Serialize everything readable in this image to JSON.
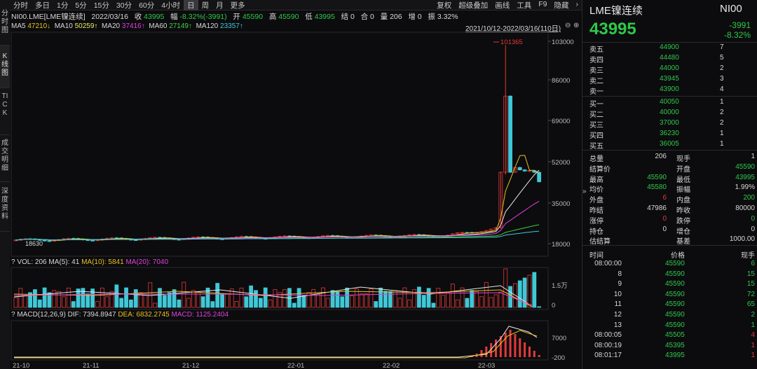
{
  "left_tabs": [
    "分时图",
    "K线图",
    "TICK",
    "成交明细",
    "深度资料"
  ],
  "periods": [
    "分时",
    "多日",
    "1分",
    "5分",
    "15分",
    "30分",
    "60分",
    "4小时",
    "日",
    "周",
    "月",
    "更多"
  ],
  "selected_period": "日",
  "toolbar_right": [
    "复权",
    "超级叠加",
    "画线",
    "工具",
    "F9",
    "隐藏"
  ],
  "info": {
    "symbol": "NI00.LME[LME镍连续]",
    "date": "2022/03/16",
    "close_label": "收",
    "close": "43995",
    "change_label": "幅",
    "change": "-8.32%(-3991)",
    "open_label": "开",
    "open": "45590",
    "high_label": "高",
    "high": "45590",
    "low_label": "低",
    "low": "43995",
    "settle_label": "结",
    "settle": "0",
    "pos_label": "合",
    "pos": "0",
    "vol_label": "量",
    "vol": "206",
    "inc_label": "增",
    "inc": "0",
    "amp_label": "振",
    "amp": "3.32%"
  },
  "ma": [
    {
      "label": "MA5",
      "value": "47210↓",
      "color": "#e8c020"
    },
    {
      "label": "MA10",
      "value": "50259↑",
      "color": "#e8e8e8"
    },
    {
      "label": "MA20",
      "value": "37416↑",
      "color": "#e040e0"
    },
    {
      "label": "MA60",
      "value": "27149↑",
      "color": "#40d040"
    },
    {
      "label": "MA120",
      "value": "23357↑",
      "color": "#40c8d8"
    }
  ],
  "range_label": "2021/10/12-2022/03/16(110日)",
  "price_axis": [
    "103000",
    "86000",
    "69000",
    "52000",
    "35000",
    "18000"
  ],
  "max_marker": "101365",
  "min_marker": "18630",
  "vol_header": {
    "vol": "VOL: 206",
    "ma5": "MA(5): 41",
    "ma10": "MA(10): 5841",
    "ma20": "MA(20): 7040"
  },
  "vol_axis": [
    "1.5万",
    "0"
  ],
  "macd_header": {
    "title": "MACD(12,26,9)",
    "dif": "DIF: 7394.8947",
    "dea": "DEA: 6832.2745",
    "macd": "MACD: 1125.2404"
  },
  "macd_axis": [
    "7000",
    "-200"
  ],
  "date_axis": [
    "21-10",
    "21-11",
    "21-12",
    "22-01",
    "22-02",
    "22-03"
  ],
  "quote": {
    "name": "LME镍连续",
    "code": "NI00",
    "price": "43995",
    "change": "-3991",
    "change_pct": "-8.32%"
  },
  "asks": [
    {
      "label": "卖五",
      "price": "44900",
      "vol": "7"
    },
    {
      "label": "卖四",
      "price": "44480",
      "vol": "5"
    },
    {
      "label": "卖三",
      "price": "44000",
      "vol": "2"
    },
    {
      "label": "卖二",
      "price": "43945",
      "vol": "3"
    },
    {
      "label": "卖一",
      "price": "43900",
      "vol": "4"
    }
  ],
  "bids": [
    {
      "label": "买一",
      "price": "40050",
      "vol": "1"
    },
    {
      "label": "买二",
      "price": "40000",
      "vol": "2"
    },
    {
      "label": "买三",
      "price": "37000",
      "vol": "2"
    },
    {
      "label": "买四",
      "price": "36230",
      "vol": "1"
    },
    {
      "label": "买五",
      "price": "36005",
      "vol": "1"
    }
  ],
  "stats": [
    {
      "l1": "总量",
      "v1": "206",
      "c1": "w",
      "l2": "现手",
      "v2": "1",
      "c2": "w"
    },
    {
      "l1": "结算价",
      "v1": "",
      "c1": "w",
      "l2": "开盘",
      "v2": "45590",
      "c2": "g"
    },
    {
      "l1": "最高",
      "v1": "45590",
      "c1": "g",
      "l2": "最低",
      "v2": "43995",
      "c2": "g"
    },
    {
      "l1": "均价",
      "v1": "45580",
      "c1": "g",
      "l2": "振幅",
      "v2": "1.99%",
      "c2": "w"
    },
    {
      "l1": "外盘",
      "v1": "6",
      "c1": "r",
      "l2": "内盘",
      "v2": "200",
      "c2": "g"
    },
    {
      "l1": "昨结",
      "v1": "47986",
      "c1": "w",
      "l2": "昨收",
      "v2": "80000",
      "c2": "w"
    },
    {
      "l1": "涨停",
      "v1": "0",
      "c1": "r",
      "l2": "跌停",
      "v2": "0",
      "c2": "g"
    },
    {
      "l1": "持仓",
      "v1": "0",
      "c1": "w",
      "l2": "增仓",
      "v2": "0",
      "c2": "w"
    },
    {
      "l1": "估结算",
      "v1": "",
      "c1": "w",
      "l2": "基差",
      "v2": "1000.00",
      "c2": "w"
    }
  ],
  "ticks_header": {
    "time": "时间",
    "price": "价格",
    "vol": "现手"
  },
  "ticks": [
    {
      "time": "08:00:00",
      "price": "45590",
      "vol": "6",
      "c": "g"
    },
    {
      "time": "8",
      "price": "45590",
      "vol": "15",
      "c": "g"
    },
    {
      "time": "9",
      "price": "45590",
      "vol": "15",
      "c": "g"
    },
    {
      "time": "10",
      "price": "45590",
      "vol": "72",
      "c": "g"
    },
    {
      "time": "11",
      "price": "45590",
      "vol": "65",
      "c": "g"
    },
    {
      "time": "12",
      "price": "45590",
      "vol": "2",
      "c": "g"
    },
    {
      "time": "13",
      "price": "45590",
      "vol": "1",
      "c": "g"
    },
    {
      "time": "08:00:05",
      "price": "45505",
      "vol": "4",
      "c": "r"
    },
    {
      "time": "08:00:19",
      "price": "45395",
      "vol": "1",
      "c": "r"
    },
    {
      "time": "08:01:17",
      "price": "43995",
      "vol": "1",
      "c": "r"
    }
  ],
  "colors": {
    "up": "#e03a3a",
    "down": "#2ec84a",
    "ma5": "#e8c020",
    "ma10": "#e8e8e8",
    "ma20": "#e040e0",
    "ma60": "#40d040",
    "ma120": "#40c8d8"
  }
}
